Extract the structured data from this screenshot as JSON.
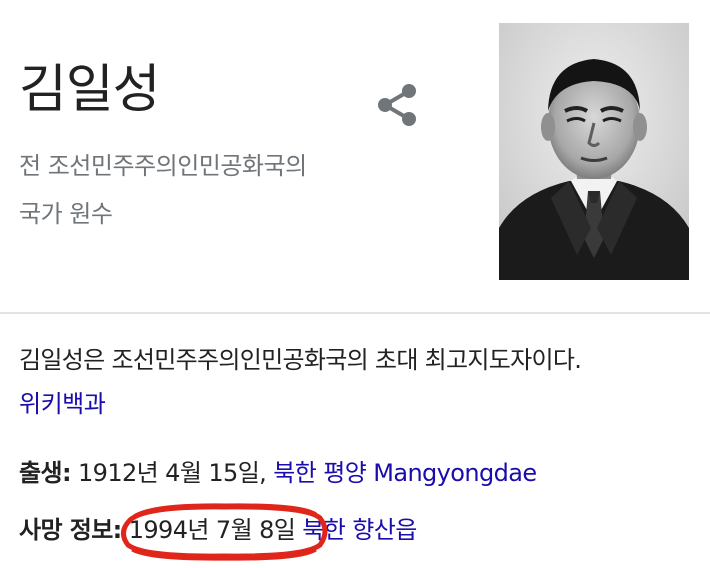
{
  "entity": {
    "title": "김일성",
    "subtitle": "전 조선민주주의인민공화국의\n국가 원수"
  },
  "description": {
    "text": "김일성은 조선민주주의인민공화국의 초대 최고지도자이다.",
    "source_label": "위키백과"
  },
  "facts": {
    "birth": {
      "label": "출생:",
      "value": " 1912년 4월 15일, ",
      "place": "북한 평양 Mangyongdae"
    },
    "death": {
      "label": "사망 정보:",
      "value": "1994년 7월 8일",
      "place": "북한 향산읍"
    }
  },
  "icons": {
    "share": "share-icon",
    "portrait": "portrait-image"
  },
  "colors": {
    "link": "#1a0dab",
    "subtitle": "#70757a",
    "annotation": "#e0261a"
  }
}
